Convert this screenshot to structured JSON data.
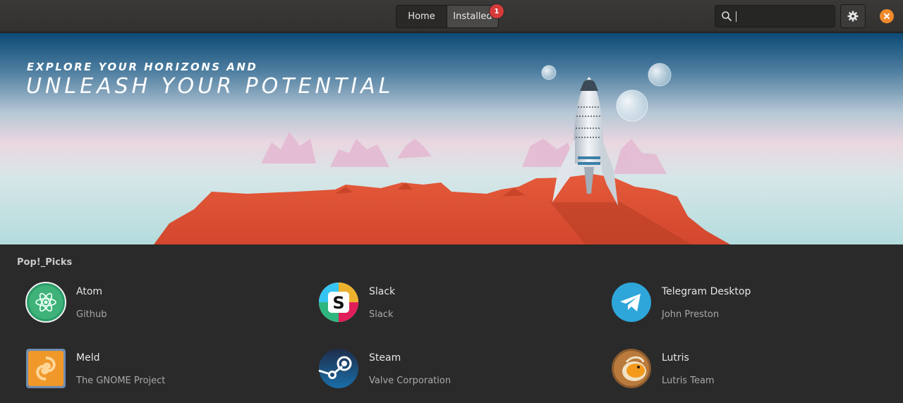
{
  "header": {
    "tabs": [
      {
        "label": "Home",
        "active": false
      },
      {
        "label": "Installed",
        "active": true,
        "badge": "1"
      }
    ],
    "search": {
      "value": "",
      "placeholder": ""
    },
    "icons": [
      "search-icon",
      "gear-icon",
      "close-icon"
    ],
    "colors": {
      "close_button": "#f08a2a",
      "badge": "#d63a3a"
    }
  },
  "banner": {
    "line1": "EXPLORE YOUR HORIZONS AND",
    "line2": "UNLEASH YOUR POTENTIAL"
  },
  "picks": {
    "title": "Pop!_Picks",
    "apps": [
      {
        "name": "Atom",
        "developer": "Github",
        "icon": "atom-icon"
      },
      {
        "name": "Slack",
        "developer": "Slack",
        "icon": "slack-icon"
      },
      {
        "name": "Telegram Desktop",
        "developer": "John Preston",
        "icon": "telegram-icon"
      },
      {
        "name": "Meld",
        "developer": "The GNOME Project",
        "icon": "meld-icon"
      },
      {
        "name": "Steam",
        "developer": "Valve Corporation",
        "icon": "steam-icon"
      },
      {
        "name": "Lutris",
        "developer": "Lutris Team",
        "icon": "lutris-icon"
      }
    ]
  }
}
